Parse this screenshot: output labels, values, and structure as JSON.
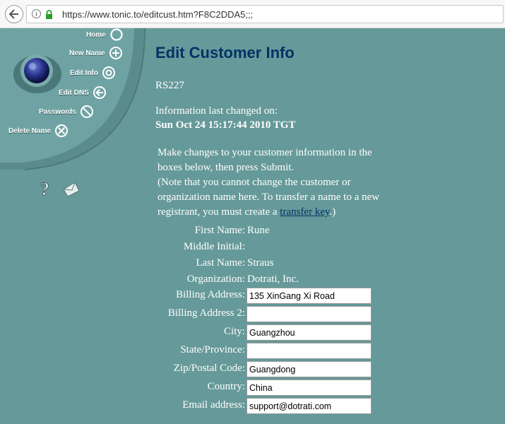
{
  "browser": {
    "url": "https://www.tonic.to/editcust.htm?F8C2DDA5;;;"
  },
  "nav": {
    "items": [
      {
        "label": "Home",
        "icon": "circle-icon"
      },
      {
        "label": "New Name",
        "icon": "plus-circle-icon"
      },
      {
        "label": "Edit Info",
        "icon": "target-icon"
      },
      {
        "label": "Edit DNS",
        "icon": "arrow-left-circle-icon"
      },
      {
        "label": "Passwords",
        "icon": "no-entry-icon"
      },
      {
        "label": "Delete Name",
        "icon": "x-box-icon"
      }
    ]
  },
  "main": {
    "title": "Edit Customer Info",
    "account_id": "RS227",
    "last_changed_label": "Information last changed on:",
    "last_changed_date": "Sun Oct 24 15:17:44 2010 TGT",
    "instructions": "Make changes to your customer information in the boxes below, then press Submit.",
    "note_prefix": "(Note that you cannot change the customer or organization name here. To transfer a name to a new registrant, you must create a",
    "note_link": "transfer key",
    "note_suffix": ".)"
  },
  "form": {
    "first_name": {
      "label": "First Name:",
      "value": "Rune"
    },
    "middle_initial": {
      "label": "Middle Initial:",
      "value": ""
    },
    "last_name": {
      "label": "Last Name:",
      "value": "Straus"
    },
    "organization": {
      "label": "Organization:",
      "value": "Dotrati, Inc."
    },
    "billing_address": {
      "label": "Billing Address:",
      "value": "135 XinGang Xi Road"
    },
    "billing_address_2": {
      "label": "Billing Address 2:",
      "value": ""
    },
    "city": {
      "label": "City:",
      "value": "Guangzhou"
    },
    "state": {
      "label": "State/Province:",
      "value": ""
    },
    "zip": {
      "label": "Zip/Postal Code:",
      "value": "Guangdong"
    },
    "country": {
      "label": "Country:",
      "value": "China"
    },
    "email": {
      "label": "Email address:",
      "value": "support@dotrati.com"
    }
  },
  "colors": {
    "background": "#669999",
    "title": "#003366",
    "link": "#003366"
  }
}
